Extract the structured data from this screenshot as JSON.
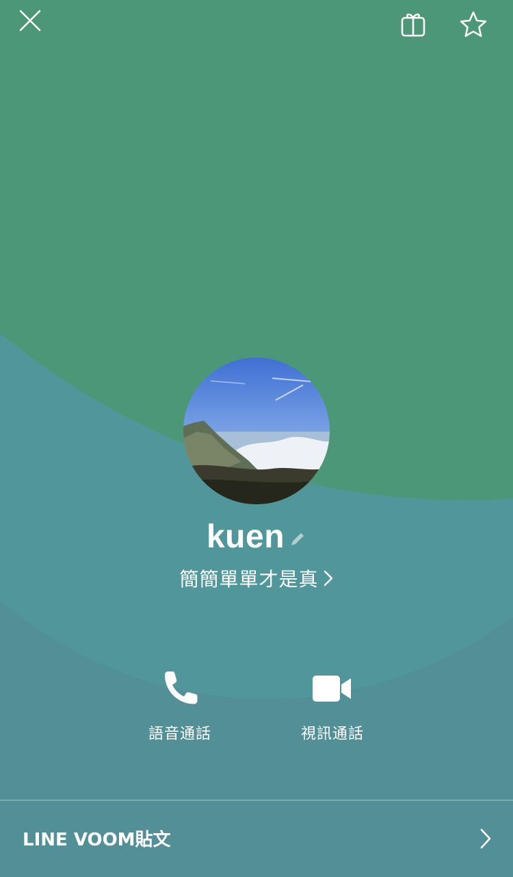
{
  "profile": {
    "name": "kuen",
    "status_message": "簡簡單單才是真"
  },
  "actions": {
    "voice_call": "語音通話",
    "video_call": "視訊通話"
  },
  "voom": {
    "label": "LINE VOOM貼文"
  },
  "icons": {
    "close": "close-icon",
    "gift": "gift-icon",
    "favorite": "star-icon",
    "edit": "pencil-icon",
    "phone": "phone-icon",
    "video": "video-camera-icon",
    "chevron": "chevron-right-icon"
  },
  "colors": {
    "top_green": "#4d9779",
    "bottom_teal": "#528f97",
    "text": "#ffffff"
  }
}
